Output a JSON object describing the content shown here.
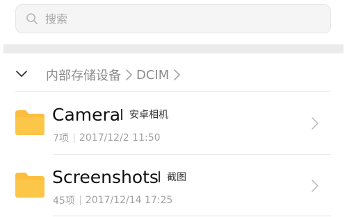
{
  "search": {
    "placeholder": "搜索",
    "icon": "search-icon"
  },
  "breadcrumb": {
    "toggle_icon": "chevron-down-icon",
    "segments": [
      "内部存储设备",
      "DCIM"
    ],
    "separator_icon": "chevron-right-icon"
  },
  "folders": [
    {
      "name": "Camera",
      "tag": "安卓相机",
      "count": "7项",
      "date": "2017/12/2 11:50",
      "icon": "folder-icon"
    },
    {
      "name": "Screenshots",
      "tag": "截图",
      "count": "45项",
      "date": "2017/12/14 17:25",
      "icon": "folder-icon"
    }
  ],
  "colors": {
    "folder": "#fbbe3e",
    "divider_band": "#ebebeb",
    "search_bg": "#f5f5f5"
  }
}
